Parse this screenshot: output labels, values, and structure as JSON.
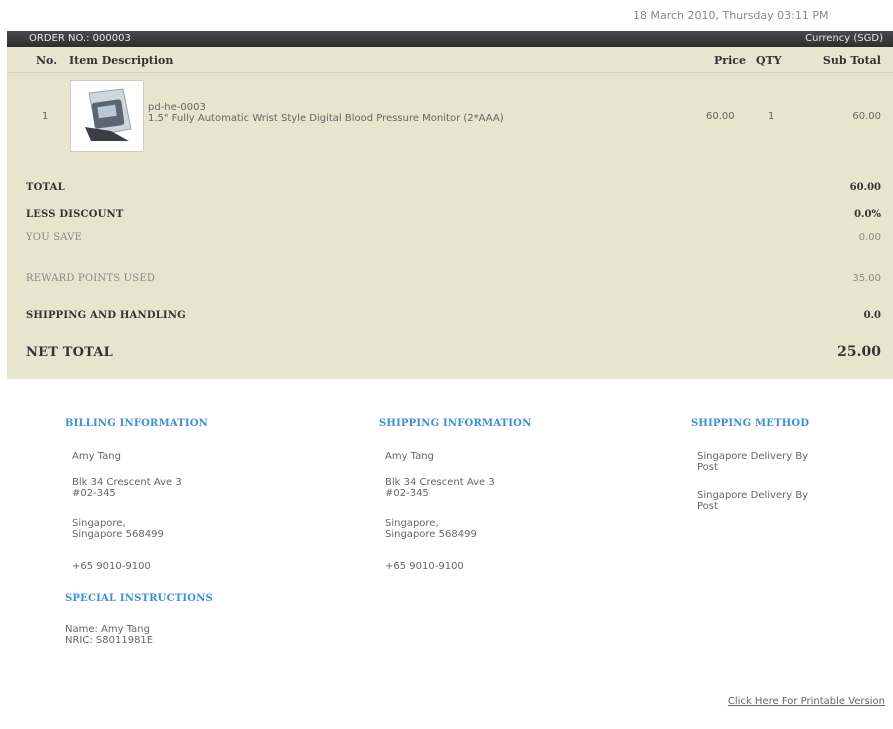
{
  "datetime": "18 March 2010, Thursday 03:11 PM",
  "order_bar": {
    "order_no": "ORDER NO.: 000003",
    "currency": "Currency (SGD)"
  },
  "table": {
    "headers": {
      "no": "No.",
      "item": "Item Description",
      "price": "Price",
      "qty": "QTY",
      "subtotal": "Sub Total"
    },
    "rows": [
      {
        "no": "1",
        "code": "pd-he-0003",
        "description": "1.5\" Fully Automatic Wrist Style Digital Blood Pressure Monitor (2*AAA)",
        "price": "60.00",
        "qty": "1",
        "subtotal": "60.00"
      }
    ]
  },
  "summary": {
    "total": {
      "label": "TOTAL",
      "value": "60.00"
    },
    "less_discount": {
      "label": "LESS DISCOUNT",
      "value": "0.0%"
    },
    "you_save": {
      "label": "YOU SAVE",
      "value": "0.00"
    },
    "reward_points": {
      "label": "REWARD POINTS USED",
      "value": "35.00"
    },
    "shipping_handling": {
      "label": "SHIPPING AND HANDLING",
      "value": "0.0"
    },
    "net_total": {
      "label": "NET TOTAL",
      "value": "25.00"
    }
  },
  "billing": {
    "title": "BILLING INFORMATION",
    "name": "Amy Tang",
    "address": "Blk 34 Crescent Ave 3\n#02-345",
    "city": "Singapore,\nSingapore 568499",
    "phone": "+65 9010-9100"
  },
  "shipping": {
    "title": "SHIPPING INFORMATION",
    "name": "Amy Tang",
    "address": "Blk 34 Crescent Ave 3\n#02-345",
    "city": "Singapore,\nSingapore 568499",
    "phone": "+65 9010-9100"
  },
  "shipping_method": {
    "title": "SHIPPING METHOD",
    "line1": "Singapore Delivery By\nPost",
    "line2": "Singapore Delivery By\nPost"
  },
  "special": {
    "title": "SPECIAL INSTRUCTIONS",
    "text": "Name: Amy Tang\nNRIC: S8011981E"
  },
  "print_link": "Click Here For Printable Version"
}
